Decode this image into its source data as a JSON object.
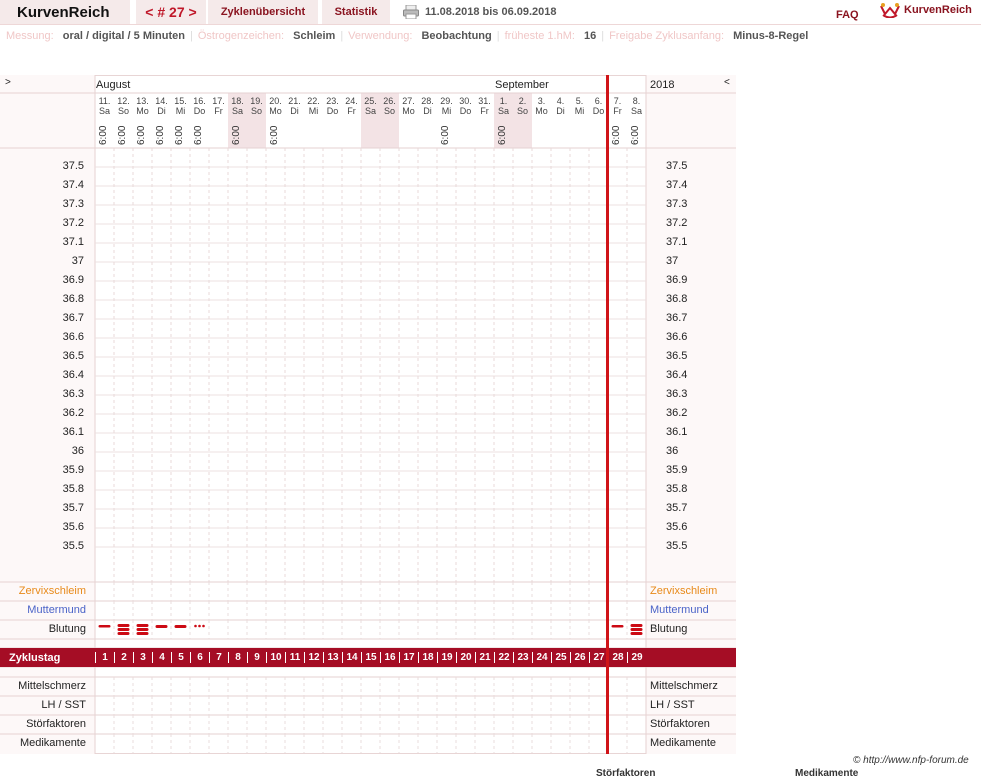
{
  "header": {
    "app_name": "KurvenReich",
    "cycle_label": "< # 27 >",
    "nav_overview": "Zyklenübersicht",
    "nav_stats": "Statistik",
    "date_range": "11.08.2018 bis 06.09.2018",
    "faq": "FAQ",
    "logo_text": "KurvenReich"
  },
  "info": [
    {
      "key": "Messung:",
      "value": "oral / digital / 5 Minuten"
    },
    {
      "key": "Östrogenzeichen:",
      "value": "Schleim"
    },
    {
      "key": "Verwendung:",
      "value": "Beobachtung"
    },
    {
      "key": "früheste 1.hM:",
      "value": "16"
    },
    {
      "key": "Freigabe Zyklusanfang:",
      "value": "Minus-8-Regel"
    }
  ],
  "chart": {
    "nav_left": ">",
    "nav_right": "<",
    "year": "2018",
    "month_1": "August",
    "month_2": "September",
    "days": [
      {
        "d": "11.",
        "wd": "Sa",
        "t": "6:00",
        "we": false
      },
      {
        "d": "12.",
        "wd": "So",
        "t": "6:00",
        "we": false
      },
      {
        "d": "13.",
        "wd": "Mo",
        "t": "6:00",
        "we": false
      },
      {
        "d": "14.",
        "wd": "Di",
        "t": "6:00",
        "we": false
      },
      {
        "d": "15.",
        "wd": "Mi",
        "t": "6:00",
        "we": false
      },
      {
        "d": "16.",
        "wd": "Do",
        "t": "6:00",
        "we": false
      },
      {
        "d": "17.",
        "wd": "Fr",
        "t": "",
        "we": false
      },
      {
        "d": "18.",
        "wd": "Sa",
        "t": "6:00",
        "we": true
      },
      {
        "d": "19.",
        "wd": "So",
        "t": "",
        "we": true
      },
      {
        "d": "20.",
        "wd": "Mo",
        "t": "6:00",
        "we": false
      },
      {
        "d": "21.",
        "wd": "Di",
        "t": "",
        "we": false
      },
      {
        "d": "22.",
        "wd": "Mi",
        "t": "",
        "we": false
      },
      {
        "d": "23.",
        "wd": "Do",
        "t": "",
        "we": false
      },
      {
        "d": "24.",
        "wd": "Fr",
        "t": "",
        "we": false
      },
      {
        "d": "25.",
        "wd": "Sa",
        "t": "",
        "we": true
      },
      {
        "d": "26.",
        "wd": "So",
        "t": "",
        "we": true
      },
      {
        "d": "27.",
        "wd": "Mo",
        "t": "",
        "we": false
      },
      {
        "d": "28.",
        "wd": "Di",
        "t": "",
        "we": false
      },
      {
        "d": "29.",
        "wd": "Mi",
        "t": "6:00",
        "we": false
      },
      {
        "d": "30.",
        "wd": "Do",
        "t": "",
        "we": false
      },
      {
        "d": "31.",
        "wd": "Fr",
        "t": "",
        "we": false
      },
      {
        "d": "1.",
        "wd": "Sa",
        "t": "6:00",
        "we": true
      },
      {
        "d": "2.",
        "wd": "So",
        "t": "",
        "we": true
      },
      {
        "d": "3.",
        "wd": "Mo",
        "t": "",
        "we": false
      },
      {
        "d": "4.",
        "wd": "Di",
        "t": "",
        "we": false
      },
      {
        "d": "5.",
        "wd": "Mi",
        "t": "",
        "we": false
      },
      {
        "d": "6.",
        "wd": "Do",
        "t": "",
        "we": false
      },
      {
        "d": "7.",
        "wd": "Fr",
        "t": "6:00",
        "we": false
      },
      {
        "d": "8.",
        "wd": "Sa",
        "t": "6:00",
        "we": false
      }
    ],
    "temps": [
      "37.5",
      "37.4",
      "37.3",
      "37.2",
      "37.1",
      "37",
      "36.9",
      "36.8",
      "36.7",
      "36.6",
      "36.5",
      "36.4",
      "36.3",
      "36.2",
      "36.1",
      "36",
      "35.9",
      "35.8",
      "35.7",
      "35.6",
      "35.5"
    ],
    "row_labels": {
      "zervix": "Zervixschleim",
      "muttermund": "Muttermund",
      "blutung": "Blutung",
      "zyklustag": "Zyklustag",
      "mittelschmerz": "Mittelschmerz",
      "lh": "LH / SST",
      "stoer": "Störfaktoren",
      "medi": "Medikamente"
    },
    "bleeding": [
      "light",
      "heavy",
      "heavy",
      "medium",
      "medium",
      "spotting",
      "",
      "",
      "",
      "",
      "",
      "",
      "",
      "",
      "",
      "",
      "",
      "",
      "",
      "",
      "",
      "",
      "",
      "",
      "",
      "",
      "",
      "light",
      "heavy"
    ],
    "cycle_days": [
      "1",
      "2",
      "3",
      "4",
      "5",
      "6",
      "7",
      "8",
      "9",
      "10",
      "11",
      "12",
      "13",
      "14",
      "15",
      "16",
      "17",
      "18",
      "19",
      "20",
      "21",
      "22",
      "23",
      "24",
      "25",
      "26",
      "27",
      "28",
      "29"
    ]
  },
  "colors": {
    "accent": "#a50d25",
    "zervix": "#e88a1a",
    "muttermund": "#4a63c8",
    "bleeding": "#cc0a14",
    "weekend_bg": "#f3e3e5"
  },
  "footer": {
    "credit": "© http://www.nfp-forum.de",
    "cut_1": "Störfaktoren",
    "cut_2": "Medikamente"
  }
}
